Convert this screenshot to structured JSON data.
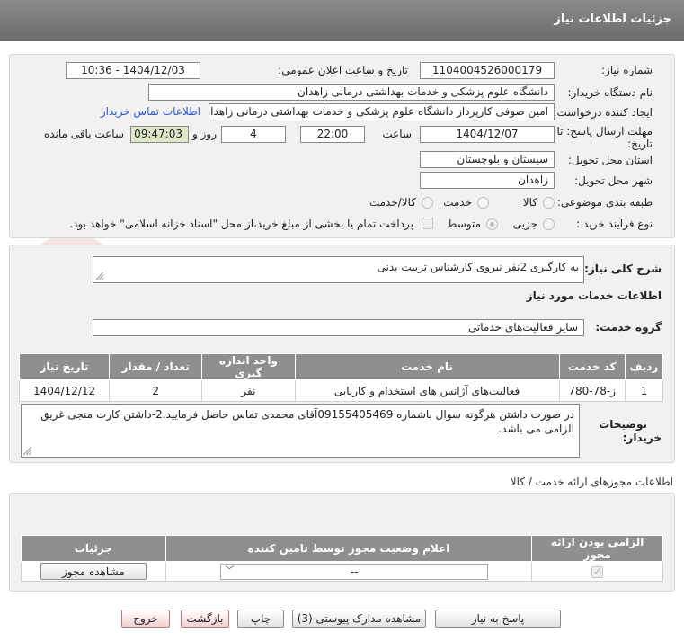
{
  "header": {
    "title": "جزئیات اطلاعات نیاز"
  },
  "info": {
    "need_number_label": "شماره نیاز:",
    "need_number": "1104004526000179",
    "announce_label": "تاریخ و ساعت اعلان عمومی:",
    "announce_value": "1404/12/03 - 10:36",
    "buyer_org_label": "نام دستگاه خریدار:",
    "buyer_org": "دانشگاه علوم پزشکی و خدمات بهداشتی درمانی زاهدان",
    "requester_label": "ایجاد کننده درخواست:",
    "requester": "امین صوفی کارپرداز دانشگاه علوم پزشکی و خدمات بهداشتی درمانی زاهدان",
    "contact_link": "اطلاعات تماس خریدار",
    "deadline_label_1": "مهلت ارسال پاسخ: تا",
    "deadline_label_2": "تاریخ:",
    "deadline_date": "1404/12/07",
    "time_label": "ساعت",
    "deadline_time": "22:00",
    "days_value": "4",
    "days_label": "روز و",
    "remaining_time": "09:47:03",
    "remaining_label": "ساعت باقی مانده",
    "province_label": "استان محل تحویل:",
    "province": "سیستان و بلوچستان",
    "city_label": "شهر محل تحویل:",
    "city": "زاهدان",
    "category_label": "طبقه بندی موضوعی:",
    "category_options": [
      "کالا",
      "خدمت",
      "کالا/خدمت"
    ],
    "process_label": "نوع فرآیند خرید :",
    "process_options": [
      "جزیی",
      "متوسط"
    ],
    "payment_note": "پرداخت تمام یا بخشی از مبلغ خرید،از محل \"اسناد خزانه اسلامی\" خواهد بود."
  },
  "details": {
    "summary_label": "شرح کلی نیاز:",
    "summary": "به کارگیری 2نفر نیروی کارشناس تربیت بدنی",
    "services_title": "اطلاعات خدمات مورد نیاز",
    "service_group_label": "گروه خدمت:",
    "service_group": "سایر فعالیت‌های خدماتی",
    "table": {
      "headers": [
        "ردیف",
        "کد خدمت",
        "نام خدمت",
        "واحد اندازه گیری",
        "تعداد / مقدار",
        "تاریخ نیاز"
      ],
      "rows": [
        [
          "1",
          "ز-78-780",
          "فعالیت‌های آژانس های استخدام و کاریابی",
          "نفر",
          "2",
          "1404/12/12"
        ]
      ]
    },
    "buyer_notes_label_1": "توضیحات",
    "buyer_notes_label_2": "خریدار:",
    "buyer_notes": "در صورت داشتن هرگونه سوال باشماره 09155405469آقای محمدی تماس حاصل فرمایید.2-داشتن کارت منجی غریق الزامی می باشد."
  },
  "permits": {
    "title": "اطلاعات مجوزهای ارائه خدمت / کالا",
    "headers": [
      "الزامی بودن ارائه مجوز",
      "اعلام وضعیت مجوز توسط تامین کننده",
      "جزئیات"
    ],
    "select_value": "--",
    "view_button": "مشاهده مجوز"
  },
  "footer": {
    "reply": "پاسخ به نیاز",
    "attachments": "مشاهده مدارک پیوستی (3)",
    "print": "چاپ",
    "back": "بازگشت",
    "exit": "خروج"
  },
  "watermark": {
    "text": "AriaTender.net"
  },
  "colors": {
    "header": "#7a7a8a",
    "link": "#2a56c6",
    "table_header": "#8f8f8f",
    "remaining_bg": "#dfe8c8",
    "watermark": "#c0392b"
  }
}
